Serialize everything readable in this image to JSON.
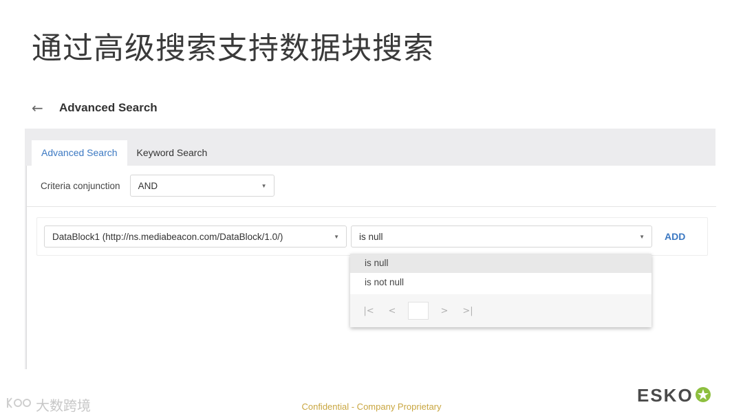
{
  "slide": {
    "title": "通过高级搜索支持数据块搜索",
    "footer_confidential": "Confidential - Company Proprietary",
    "watermark_text": "大数跨境",
    "watermark_icon": "kol-logo-icon",
    "brand": "ESKO",
    "brand_mark": "esko-star-icon",
    "brand_mark_color": "#8dbf3f"
  },
  "header": {
    "back_icon": "arrow-left-icon",
    "back_glyph": "←",
    "title": "Advanced Search"
  },
  "tabs": [
    {
      "label": "Advanced Search",
      "active": true
    },
    {
      "label": "Keyword Search",
      "active": false
    }
  ],
  "conjunction": {
    "label": "Criteria conjunction",
    "value": "AND"
  },
  "criteria": {
    "field_value": "DataBlock1 (http://ns.mediabeacon.com/DataBlock/1.0/)",
    "operator_value": "is null",
    "add_label": "ADD"
  },
  "dropdown": {
    "options": [
      "is null",
      "is not null"
    ],
    "selected_index": 0,
    "pager": {
      "first": "|<",
      "prev": "<",
      "next": ">",
      "last": ">|"
    }
  },
  "colors": {
    "accent": "#3b78c2",
    "panel_bg": "#ececee",
    "footer_text": "#c9a640"
  }
}
